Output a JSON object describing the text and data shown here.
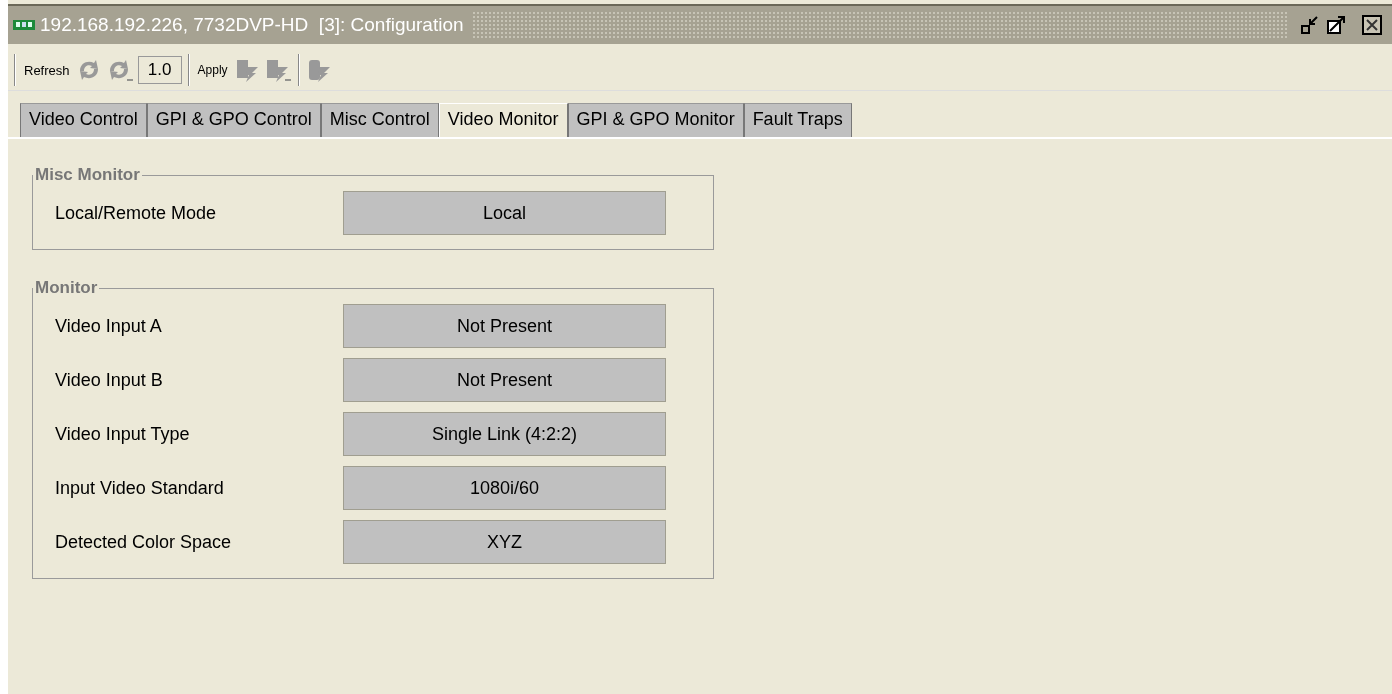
{
  "window": {
    "title": "192.168.192.226, 7732DVP-HD  [3]: Configuration"
  },
  "toolbar": {
    "refresh_label": "Refresh",
    "interval": "1.0",
    "apply_label": "Apply"
  },
  "tabs": [
    {
      "label": "Video Control",
      "selected": false
    },
    {
      "label": "GPI & GPO Control",
      "selected": false
    },
    {
      "label": "Misc Control",
      "selected": false
    },
    {
      "label": "Video Monitor",
      "selected": true
    },
    {
      "label": "GPI & GPO Monitor",
      "selected": false
    },
    {
      "label": "Fault Traps",
      "selected": false
    }
  ],
  "groups": [
    {
      "title": "Misc Monitor",
      "rows": [
        {
          "label": "Local/Remote Mode",
          "value": "Local"
        }
      ]
    },
    {
      "title": "Monitor",
      "rows": [
        {
          "label": "Video Input A",
          "value": "Not Present"
        },
        {
          "label": "Video Input B",
          "value": "Not Present"
        },
        {
          "label": "Video Input Type",
          "value": "Single Link (4:2:2)"
        },
        {
          "label": "Input Video Standard",
          "value": "1080i/60"
        },
        {
          "label": "Detected Color Space",
          "value": "XYZ"
        }
      ]
    }
  ]
}
